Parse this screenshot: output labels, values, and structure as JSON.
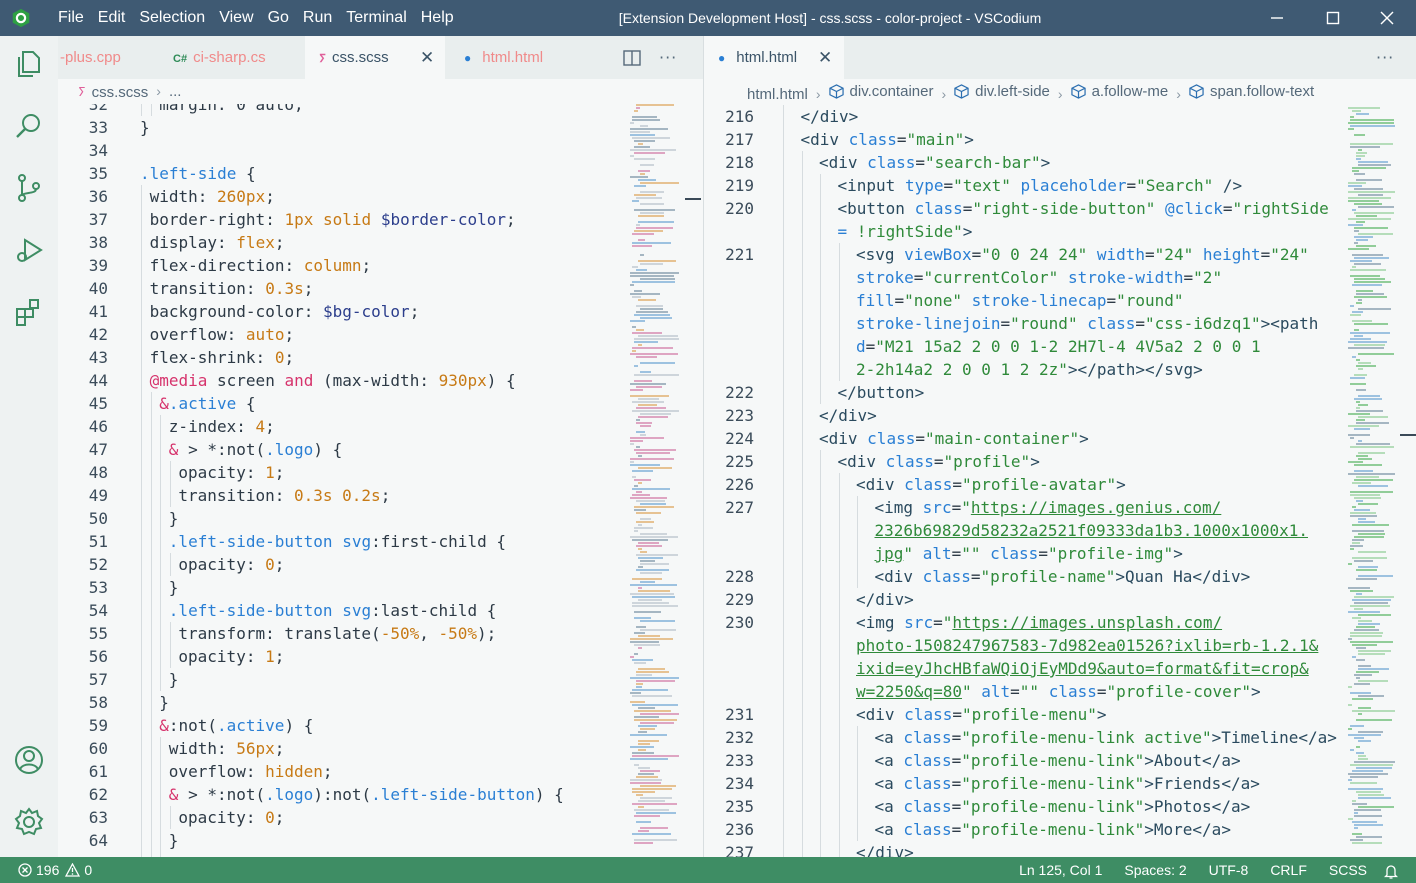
{
  "window": {
    "title": "[Extension Development Host] - css.scss - color-project - VSCodium",
    "menu": [
      "File",
      "Edit",
      "Selection",
      "View",
      "Go",
      "Run",
      "Terminal",
      "Help"
    ]
  },
  "activity_bar": [
    "explorer-icon",
    "search-icon",
    "source-control-icon",
    "run-debug-icon",
    "extensions-icon",
    "account-icon",
    "settings-gear-icon"
  ],
  "left_group": {
    "tabs": [
      {
        "label": "-plus.cpp",
        "state": "inactive"
      },
      {
        "label": "ci-sharp.cs",
        "icon": "C#",
        "state": "inactive"
      },
      {
        "label": "css.scss",
        "state": "active"
      },
      {
        "label": "html.html",
        "state": "inactive-modified"
      }
    ],
    "breadcrumb": [
      "css.scss",
      "..."
    ]
  },
  "right_group": {
    "tabs": [
      {
        "label": "html.html",
        "state": "active-modified"
      }
    ],
    "breadcrumb": [
      "html.html",
      "div.container",
      "div.left-side",
      "a.follow-me",
      "span.follow-text"
    ]
  },
  "status_bar": {
    "errors": "196",
    "warnings": "0",
    "position": "Ln 125, Col 1",
    "spaces": "Spaces: 2",
    "encoding": "UTF-8",
    "eol": "CRLF",
    "language": "SCSS"
  },
  "colors": {
    "title_bar": "#3f5a73",
    "status_bar": "#3e8d64",
    "editor_bg": "#f6f8f8"
  }
}
